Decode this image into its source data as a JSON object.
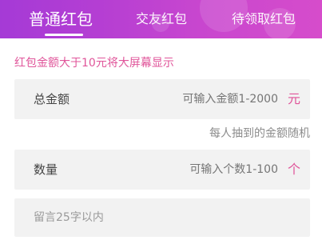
{
  "tabs": [
    {
      "label": "普通红包",
      "active": true
    },
    {
      "label": "交友红包",
      "active": false
    },
    {
      "label": "待领取红包",
      "active": false
    }
  ],
  "notice": "红包金额大于10元将大屏幕显示",
  "amount_field": {
    "label": "总金额",
    "placeholder": "可输入金额1-2000",
    "unit": "元"
  },
  "random_hint": "每人抽到的金额随机",
  "count_field": {
    "label": "数量",
    "placeholder": "可输入个数1-100",
    "unit": "个"
  },
  "message_field": {
    "placeholder": "留言25字以内"
  },
  "colors": {
    "header_gradient_start": "#a53ad6",
    "header_gradient_end": "#d64ccb",
    "accent": "#e0559a",
    "field_background": "#f2f2f2"
  }
}
